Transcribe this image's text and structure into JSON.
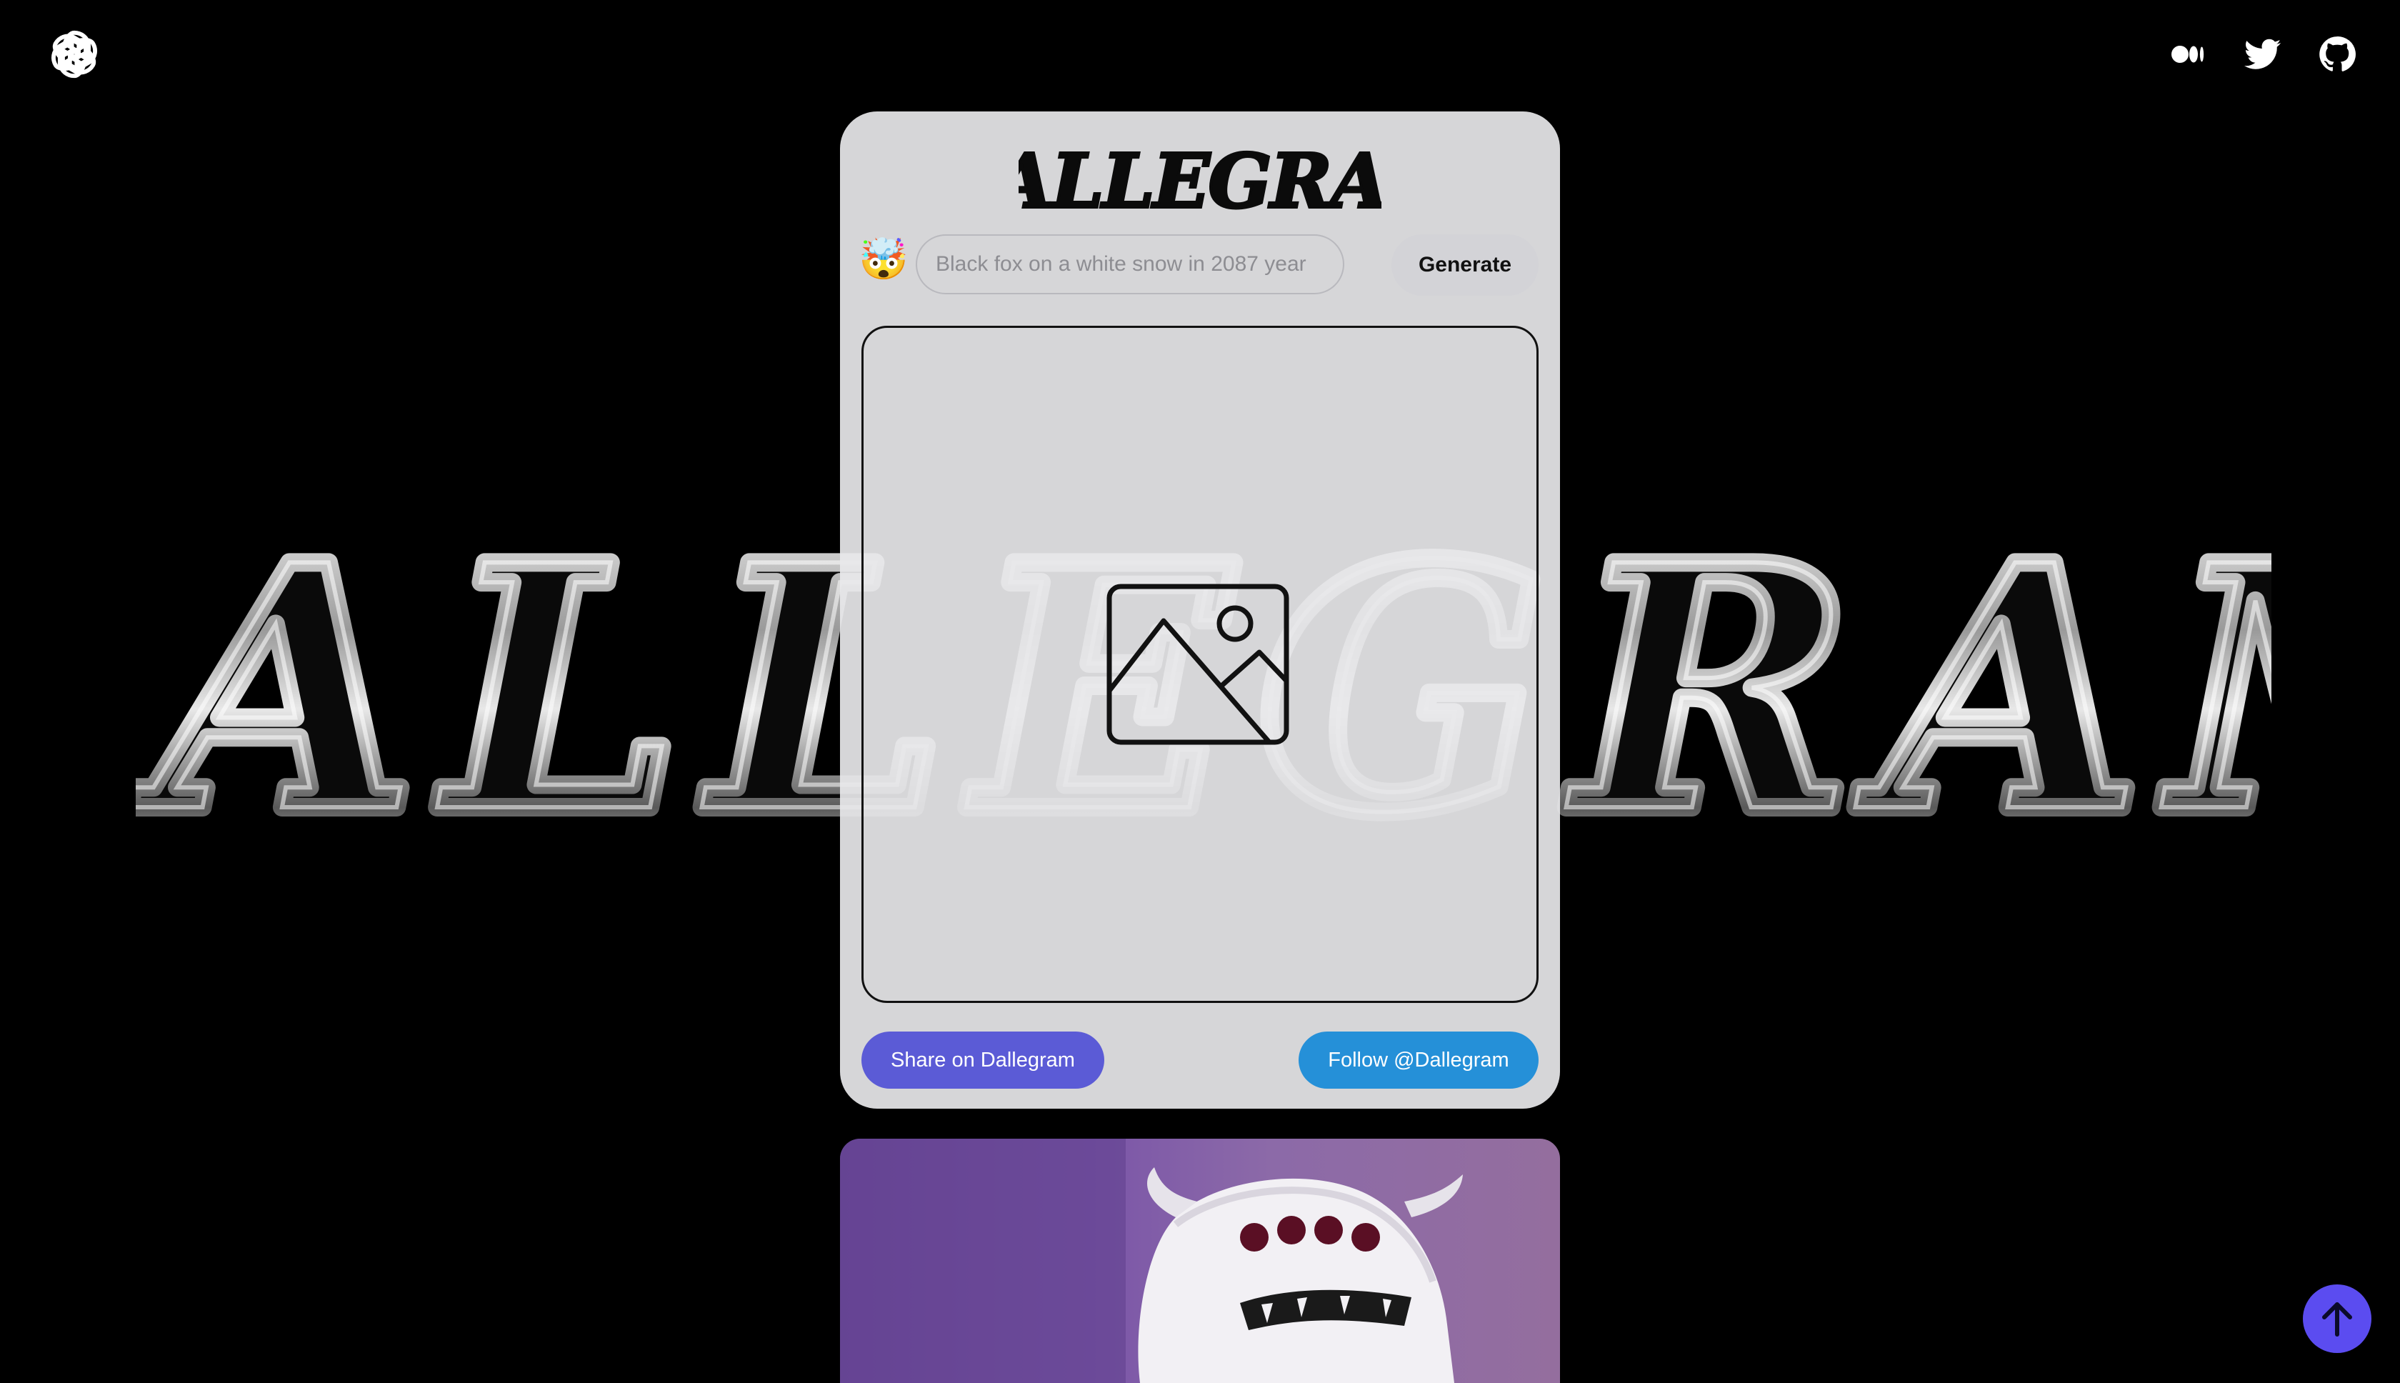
{
  "header": {
    "logo_icon": "openai-logo-icon",
    "social": [
      {
        "name": "medium-icon"
      },
      {
        "name": "twitter-icon"
      },
      {
        "name": "github-icon"
      }
    ]
  },
  "background": {
    "wordmark": "DALLEGRAM"
  },
  "card": {
    "title": "DALLEGRAM",
    "avatar_emoji": "🤯",
    "prompt": {
      "value": "",
      "placeholder": "Black fox on a white snow in 2087 year"
    },
    "generate_label": "Generate",
    "image_placeholder_icon": "image-icon",
    "share_label": "Share on Dallegram",
    "follow_label": "Follow @Dallegram"
  },
  "feed": {
    "image_subject": "white furry monster on purple background"
  },
  "scroll_top_icon": "arrow-up-icon",
  "colors": {
    "background": "#000000",
    "card": "#e8e8ea",
    "share_button": "#5b5bd6",
    "follow_button": "#2590d8",
    "scroll_top": "#5b4cf0"
  }
}
